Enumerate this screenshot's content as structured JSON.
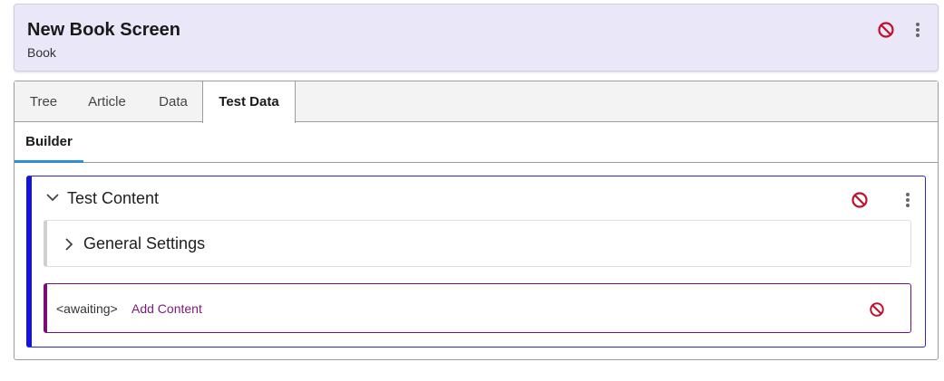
{
  "header": {
    "title": "New Book Screen",
    "subtitle": "Book",
    "cancel_icon": "cancel-icon",
    "more_icon": "more-vertical-icon"
  },
  "tabs": [
    {
      "label": "Tree",
      "active": false
    },
    {
      "label": "Article",
      "active": false
    },
    {
      "label": "Data",
      "active": false
    },
    {
      "label": "Test Data",
      "active": true
    }
  ],
  "subtabs": [
    {
      "label": "Builder",
      "active": true
    }
  ],
  "content": {
    "title": "Test Content",
    "expanded": true,
    "settings": {
      "title": "General Settings",
      "expanded": false
    },
    "add_slot": {
      "status": "<awaiting>",
      "link": "Add Content"
    }
  },
  "colors": {
    "header_bg": "#eae8f8",
    "cancel_red": "#c0102a",
    "content_border": "#1212e6",
    "add_border": "#7a0f7a",
    "subtab_underline": "#2d8fd5"
  }
}
